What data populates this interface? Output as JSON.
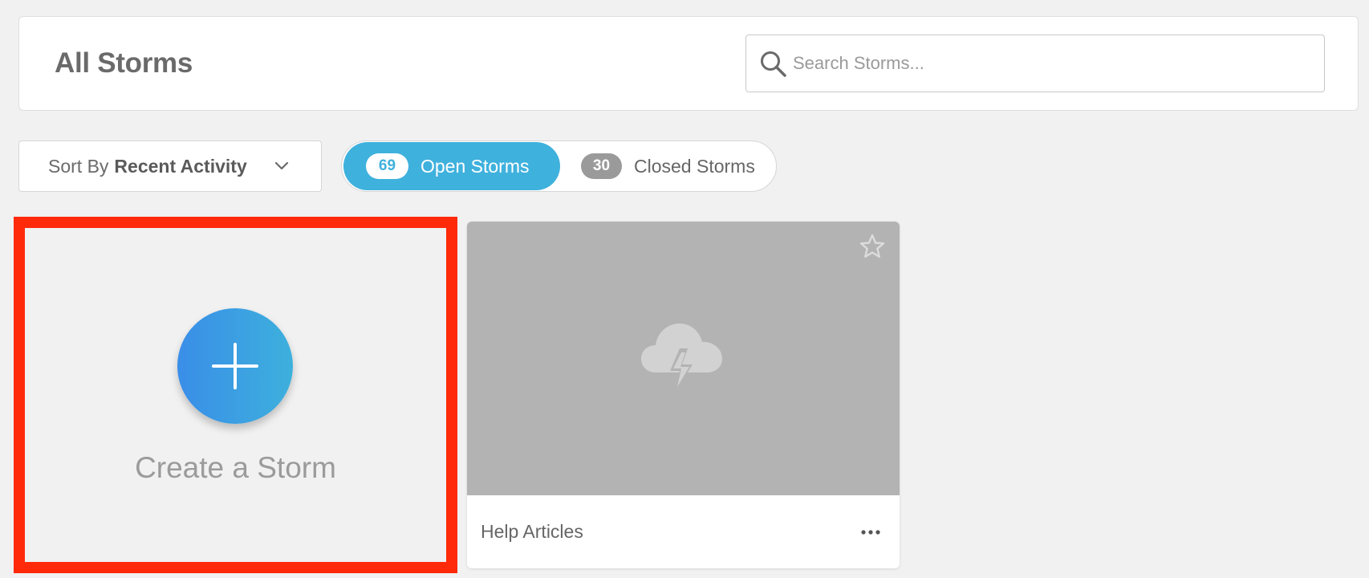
{
  "header": {
    "title": "All Storms",
    "search_placeholder": "Search Storms..."
  },
  "sort": {
    "prefix": "Sort By",
    "value": "Recent Activity"
  },
  "filter_tabs": {
    "open": {
      "count": "69",
      "label": "Open Storms",
      "active": true
    },
    "closed": {
      "count": "30",
      "label": "Closed Storms",
      "active": false
    }
  },
  "create_card": {
    "label": "Create a Storm"
  },
  "storms": [
    {
      "name": "Help Articles",
      "starred": false,
      "icon": "cloud-lightning-icon"
    }
  ],
  "colors": {
    "accent": "#3fb1dd",
    "gradient_start": "#3a8ee8",
    "highlight_border": "#ff2a0a",
    "thumb_bg": "#b3b3b3"
  }
}
